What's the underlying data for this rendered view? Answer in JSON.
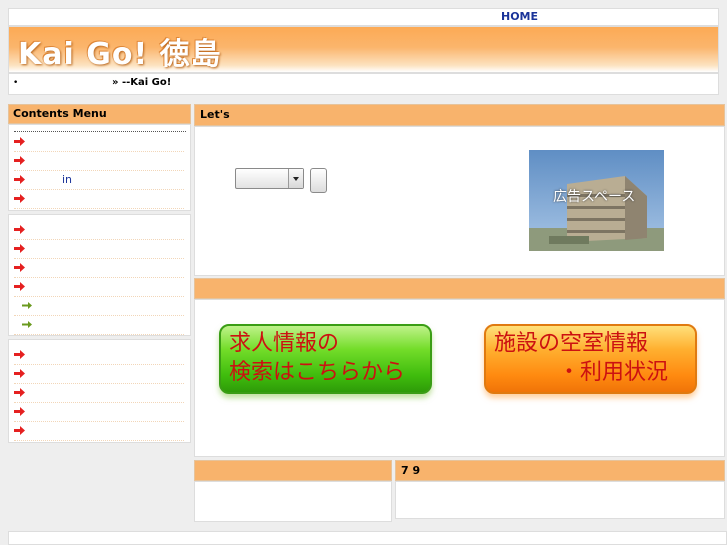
{
  "header": {
    "home_link": "HOME",
    "site_title": "Kai Go! 徳島"
  },
  "breadcrumb": {
    "bullet": "•",
    "text": "» --Kai Go!"
  },
  "sidebar": {
    "menu_title": "Contents Menu",
    "group1": [
      {
        "label": "",
        "icon": "red-arrow-icon"
      },
      {
        "label": "",
        "icon": "red-arrow-icon"
      },
      {
        "label": "in",
        "icon": "red-arrow-icon"
      },
      {
        "label": "",
        "icon": "red-arrow-icon"
      }
    ],
    "group2": [
      {
        "label": "",
        "icon": "red-arrow-icon"
      },
      {
        "label": "",
        "icon": "red-arrow-icon"
      },
      {
        "label": "",
        "icon": "red-arrow-icon"
      },
      {
        "label": "",
        "icon": "red-arrow-icon"
      },
      {
        "label": "",
        "icon": "green-arrow-icon"
      },
      {
        "label": "",
        "icon": "green-arrow-icon"
      }
    ],
    "group3": [
      {
        "label": "",
        "icon": "red-arrow-icon"
      },
      {
        "label": "",
        "icon": "red-arrow-icon"
      },
      {
        "label": "",
        "icon": "red-arrow-icon"
      },
      {
        "label": "",
        "icon": "red-arrow-icon"
      },
      {
        "label": "",
        "icon": "red-arrow-icon"
      }
    ]
  },
  "main": {
    "panel1_title": "Let's",
    "select_value": "",
    "search_button": "",
    "ad_text": "広告スペース",
    "panel2_title": "",
    "job_button_line1": "求人情報の",
    "job_button_line2": "検索はこちらから",
    "facility_button_line1": "施設の空室情報",
    "facility_button_line2": "・利用状況",
    "bottom_left_title": "",
    "bottom_right_title": "7 9"
  },
  "colors": {
    "orange_accent": "#f8b36c",
    "link_blue": "#1a3399",
    "button_text_red": "#cc1111"
  }
}
